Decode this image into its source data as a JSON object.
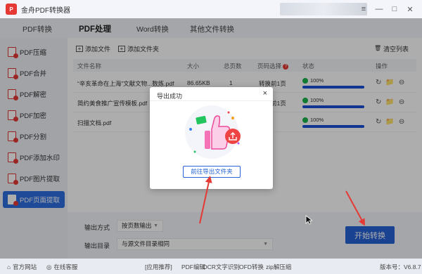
{
  "app": {
    "title": "金舟PDF转换器",
    "logo_text": "P"
  },
  "window_controls": {
    "menu": "≡",
    "minimize": "—",
    "maximize": "□",
    "close": "✕"
  },
  "top_tabs": [
    {
      "label": "PDF转换"
    },
    {
      "label": "PDF处理"
    },
    {
      "label": "Word转换"
    },
    {
      "label": "其他文件转换"
    }
  ],
  "sidebar": {
    "items": [
      {
        "label": "PDF压缩"
      },
      {
        "label": "PDF合并"
      },
      {
        "label": "PDF解密"
      },
      {
        "label": "PDF加密"
      },
      {
        "label": "PDF分割"
      },
      {
        "label": "PDF添加水印"
      },
      {
        "label": "PDF图片提取"
      },
      {
        "label": "PDF页面提取"
      }
    ]
  },
  "toolbar": {
    "add_file": "添加文件",
    "add_folder": "添加文件夹",
    "clear_list": "清空列表"
  },
  "table": {
    "headers": {
      "name": "文件名称",
      "size": "大小",
      "pages": "总页数",
      "page_select": "页码选择",
      "status": "状态",
      "ops": "操作"
    },
    "page_select_badge": "?",
    "rows": [
      {
        "name": "“辛亥革命在上海”文献文物...数炼.pdf",
        "size": "86.65KB",
        "pages": "1",
        "page_select": "转换前1页",
        "progress_text": "100%",
        "progress": 1.0
      },
      {
        "name": "简约美食推广宣传模板.pdf",
        "size": "",
        "pages": "",
        "page_select": "转换前1页",
        "progress_text": "100%",
        "progress": 1.0
      },
      {
        "name": "扫描文档.pdf",
        "size": "",
        "pages": "",
        "page_select": "",
        "progress_text": "100%",
        "progress": 1.0
      }
    ],
    "op_icons": [
      "↻",
      "📁",
      "⊖"
    ]
  },
  "bottom": {
    "output_mode_label": "输出方式",
    "output_mode_value": "按页数输出",
    "output_dir_label": "输出目录",
    "output_dir_value": "与源文件目录相同",
    "start_button": "开始转换"
  },
  "dialog": {
    "title": "导出成功",
    "close": "×",
    "button": "前往导出文件夹"
  },
  "statusbar": {
    "website": "官方网站",
    "support": "在线客服",
    "app_recommend": "[应用推荐]",
    "pdf_edit": "PDF编辑",
    "ocr": "OCR文字识别",
    "ofd": "OFD转换",
    "zip": "zip解压缩",
    "version_label": "版本号：",
    "version": "V6.8.7"
  },
  "colors": {
    "accent": "#2563d6",
    "brand": "#e53935",
    "arrow": "#e53935",
    "success": "#19b34a"
  }
}
